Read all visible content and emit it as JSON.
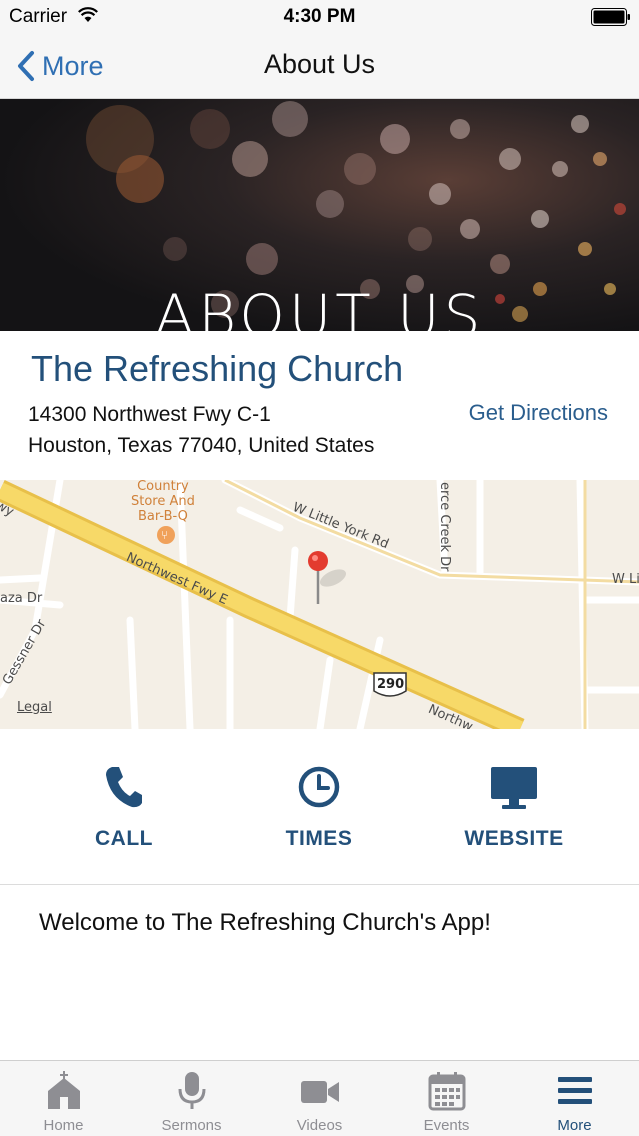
{
  "status_bar": {
    "carrier": "Carrier",
    "time": "4:30 PM"
  },
  "nav": {
    "back_label": "More",
    "title": "About Us"
  },
  "hero": {
    "title": "ABOUT US"
  },
  "church": {
    "name": "The Refreshing Church",
    "address_line1": "14300 Northwest Fwy C-1",
    "address_line2": "Houston, Texas 77040, United States",
    "directions_label": "Get Directions"
  },
  "map": {
    "labels": {
      "w_little_york": "W Little York Rd",
      "w_li": "W Li",
      "northwest_fwy": "Northwest Fwy E",
      "northw": "Northw",
      "gessner": "Gessner Dr",
      "plaza": "aza Dr",
      "pierce_creek": "erce Creek Dr",
      "wy": "wy",
      "route": "290"
    },
    "poi_line1": "Country",
    "poi_line2": "Store And",
    "poi_line3": "Bar-B-Q",
    "legal": "Legal"
  },
  "actions": {
    "call": "CALL",
    "times": "TIMES",
    "website": "WEBSITE"
  },
  "welcome_text": "Welcome to The Refreshing Church's App!",
  "tabs": [
    {
      "label": "Home",
      "icon": "church-icon"
    },
    {
      "label": "Sermons",
      "icon": "microphone-icon"
    },
    {
      "label": "Videos",
      "icon": "video-camera-icon"
    },
    {
      "label": "Events",
      "icon": "calendar-icon"
    },
    {
      "label": "More",
      "icon": "menu-icon"
    }
  ],
  "colors": {
    "accent": "#23507a",
    "link": "#2f6fb3",
    "tab_inactive": "#8e8e93"
  }
}
